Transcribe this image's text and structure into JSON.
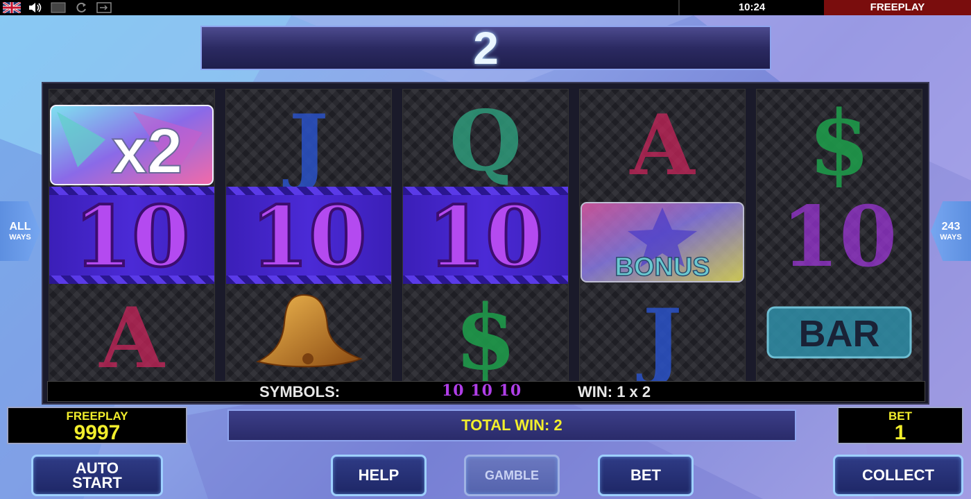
{
  "top_bar": {
    "icons": [
      "uk-flag-icon",
      "speaker-icon",
      "fullscreen-icon",
      "reload-icon",
      "window-icon"
    ],
    "clock": "10:24",
    "mode": "FREEPLAY"
  },
  "win_display": {
    "value": "2"
  },
  "ways": {
    "left_big": "ALL",
    "left_small": "WAYS",
    "right_big": "243",
    "right_small": "WAYS"
  },
  "reels": [
    [
      "multiplier_x2",
      "10",
      "A"
    ],
    [
      "J",
      "10",
      "bell"
    ],
    [
      "Q",
      "10",
      "$"
    ],
    [
      "A",
      "bonus",
      "J"
    ],
    [
      "$",
      "10",
      "bar"
    ]
  ],
  "reel_text": {
    "x2": "x2",
    "bonus": "BONUS",
    "bar": "BAR"
  },
  "colors": {
    "ten": "#a236e0",
    "J": "#2a52c8",
    "Q": "#2e9a7a",
    "A": "#c8245a",
    "dollar": "#1e9a4a",
    "highlight": "#4b2ad6",
    "yellow_text": "#f2ee2c"
  },
  "symbols_bar": {
    "label": "SYMBOLS:",
    "symbols": "10 10 10",
    "win": "WIN: 1 x 2"
  },
  "balance": {
    "label": "FREEPLAY",
    "value": "9997"
  },
  "total_win": "TOTAL WIN: 2",
  "bet": {
    "label": "BET",
    "value": "1"
  },
  "buttons": {
    "auto_line1": "AUTO",
    "auto_line2": "START",
    "help": "HELP",
    "gamble": "GAMBLE",
    "bet": "BET",
    "collect": "COLLECT"
  }
}
